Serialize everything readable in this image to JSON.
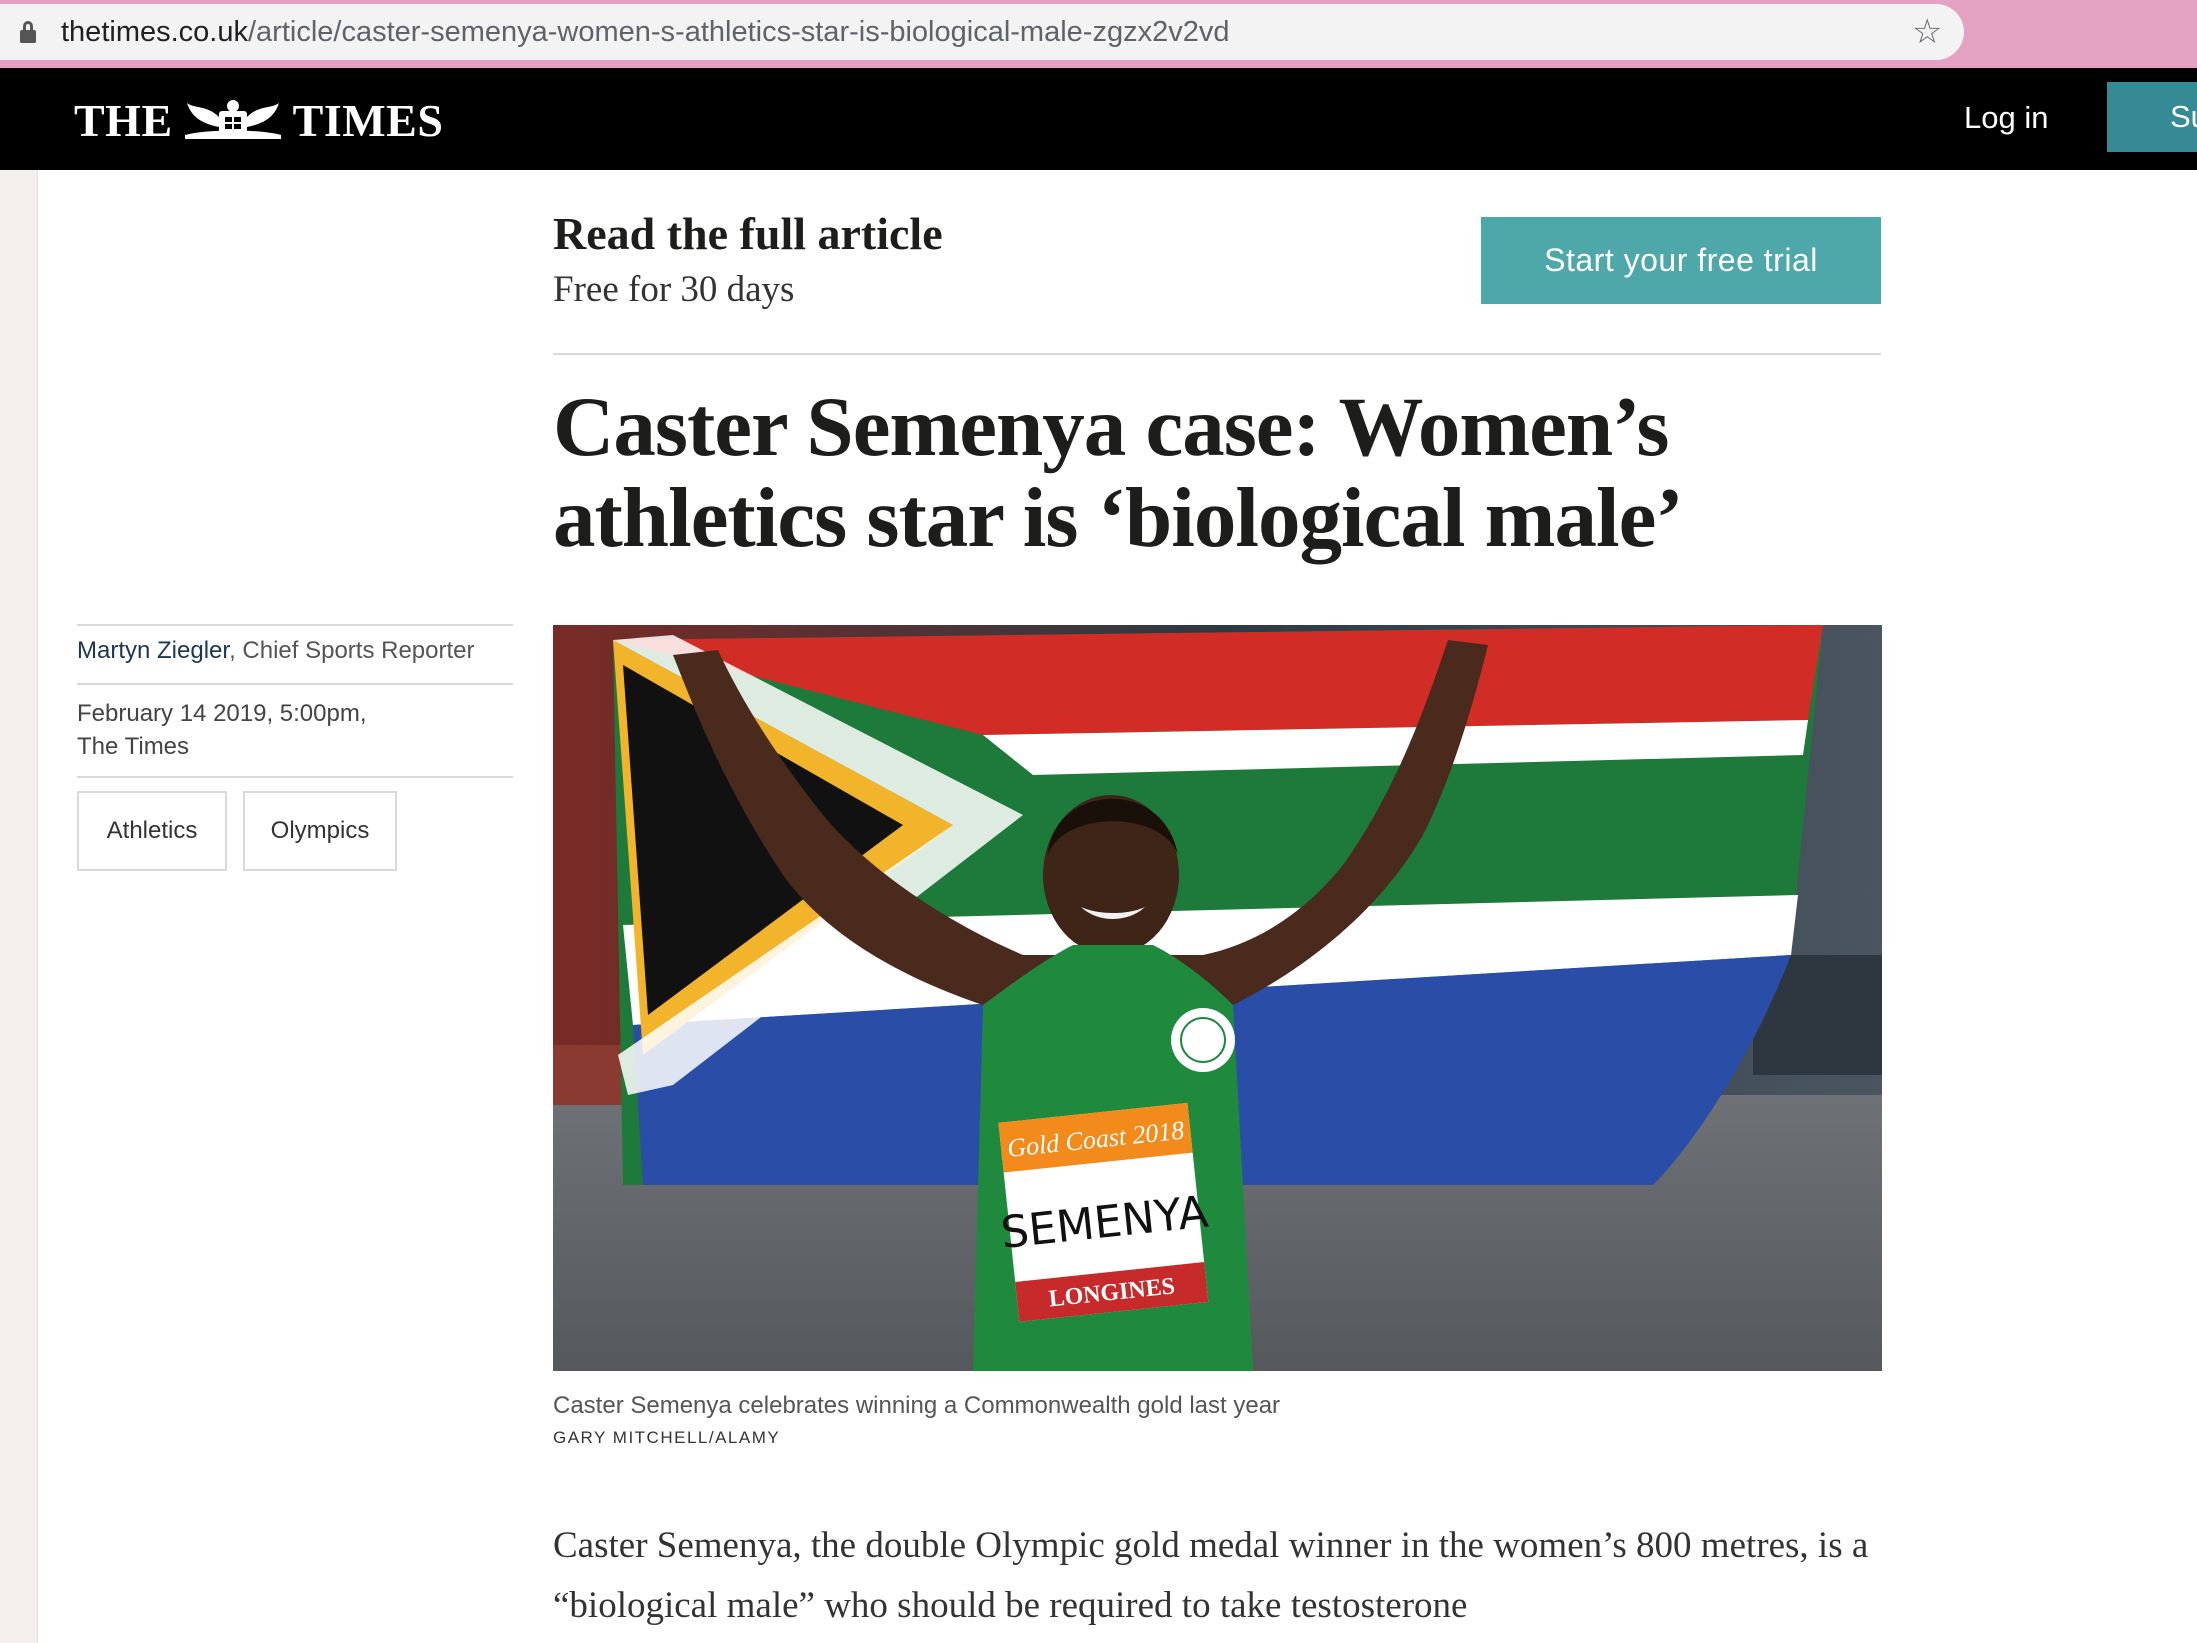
{
  "browser": {
    "url_domain": "thetimes.co.uk",
    "url_path": "/article/caster-semenya-women-s-athletics-star-is-biological-male-zgzx2v2vd"
  },
  "masthead": {
    "logo_left": "THE",
    "logo_right": "TIMES",
    "login_label": "Log in",
    "subscribe_label": "Su"
  },
  "promo": {
    "title": "Read the full article",
    "subtitle": "Free for 30 days",
    "button_label": "Start your free trial"
  },
  "article": {
    "headline": "Caster Semenya case: Women’s athletics star is ‘biological male’",
    "author": "Martyn Ziegler",
    "author_role": ", Chief Sports Reporter",
    "date": "February 14 2019, 5:00pm,",
    "publication": "The Times",
    "tags": [
      "Athletics",
      "Olympics"
    ],
    "image_bib_event": "Gold Coast 2018",
    "image_bib_name": "SEMENYA",
    "image_bib_sponsor": "LONGINES",
    "caption": "Caster Semenya celebrates winning a Commonwealth gold last year",
    "credit": "GARY MITCHELL/ALAMY",
    "body": "Caster Semenya, the double Olympic gold medal winner in the women’s 800 metres, is a “biological male” who should be required to take testosterone"
  },
  "colors": {
    "accent_teal": "#4ea7a9",
    "subscribe_teal": "#368a96",
    "chrome_pink": "#e4a2c3",
    "masthead_black": "#000000"
  },
  "icons": [
    "lock-icon",
    "bookmark-star-icon",
    "times-crest-icon"
  ]
}
